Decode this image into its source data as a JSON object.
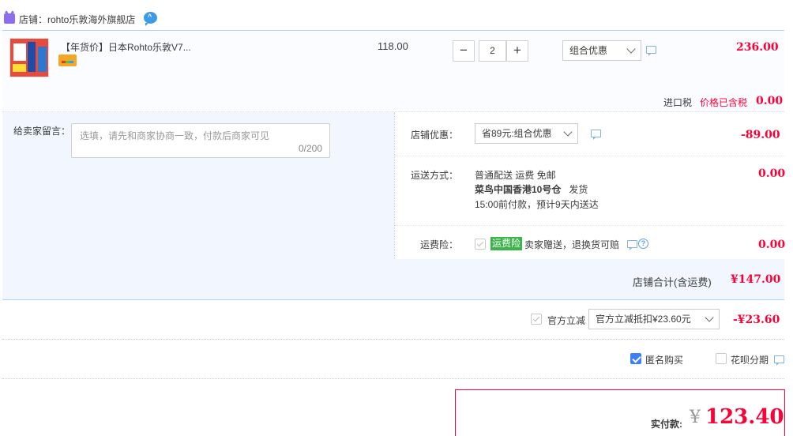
{
  "shop": {
    "label": "店铺：rohto乐敦海外旗舰店"
  },
  "item": {
    "title": "【年货价】日本Rohto乐敦V7...",
    "unit_price": "118.00",
    "quantity": "2",
    "minus": "−",
    "plus": "+",
    "promo_select": "组合优惠",
    "line_total": "236.00",
    "tax_label": "进口税",
    "tax_note": "价格已含税",
    "tax_value": "0.00"
  },
  "message": {
    "label": "给卖家留言：",
    "placeholder": "选填，请先和商家协商一致，付款后商家可见",
    "count": "0/200"
  },
  "shop_discount": {
    "label": "店铺优惠：",
    "select": "省89元:组合优惠",
    "value": "-89.00"
  },
  "shipping": {
    "label": "运送方式：",
    "line1": "普通配送 运费 免邮",
    "line2_bold": "菜鸟中国香港10号仓",
    "line2_rest": "发货",
    "line3": "15:00前付款，预计9天内送达",
    "value": "0.00"
  },
  "insurance": {
    "label": "运费险：",
    "tag": "运费险",
    "text": "卖家赠送，退换货可赔",
    "value": "0.00"
  },
  "subtotal": {
    "label": "店铺合计(含运费)",
    "value": "¥147.00"
  },
  "official_discount": {
    "label": "官方立减",
    "select": "官方立减抵扣¥23.60元",
    "value": "-¥23.60"
  },
  "options": {
    "anonymous": "匿名购买",
    "installment": "花呗分期"
  },
  "total": {
    "label": "实付款:",
    "currency": "¥",
    "value": "123.40"
  },
  "colors": {
    "accent_red": "#ff0036",
    "border_blue": "#b2d1ff",
    "light_blue_bg": "#f2f7ff",
    "checkbox_blue": "#3d7ff5",
    "tag_green": "#3bb44a"
  }
}
